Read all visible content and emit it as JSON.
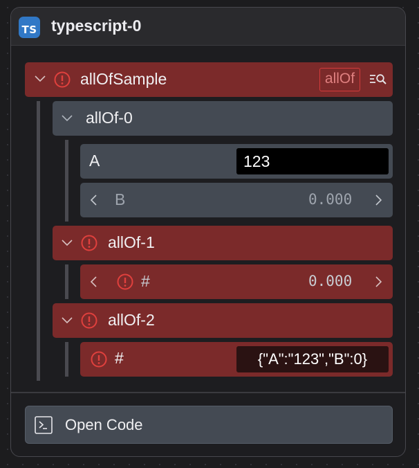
{
  "node": {
    "badge": "TS",
    "title": "typescript-0",
    "accent": "#3178c6"
  },
  "root": {
    "label": "allOfSample",
    "tag": "allOf",
    "icons": [
      "chevron-down-icon",
      "error-icon",
      "search-list-icon"
    ],
    "status_color": "#7b2a2a"
  },
  "allof0": {
    "label": "allOf-0",
    "field_a": {
      "label": "A",
      "value": "123"
    },
    "field_b": {
      "label": "B",
      "value": "0.000"
    }
  },
  "allof1": {
    "label": "allOf-1",
    "field": {
      "label": "#",
      "value": "0.000"
    }
  },
  "allof2": {
    "label": "allOf-2",
    "field": {
      "label": "#",
      "value": "{\"A\":\"123\",\"B\":0}"
    }
  },
  "footer": {
    "open_code_label": "Open Code",
    "open_code_icon": "terminal-icon"
  }
}
